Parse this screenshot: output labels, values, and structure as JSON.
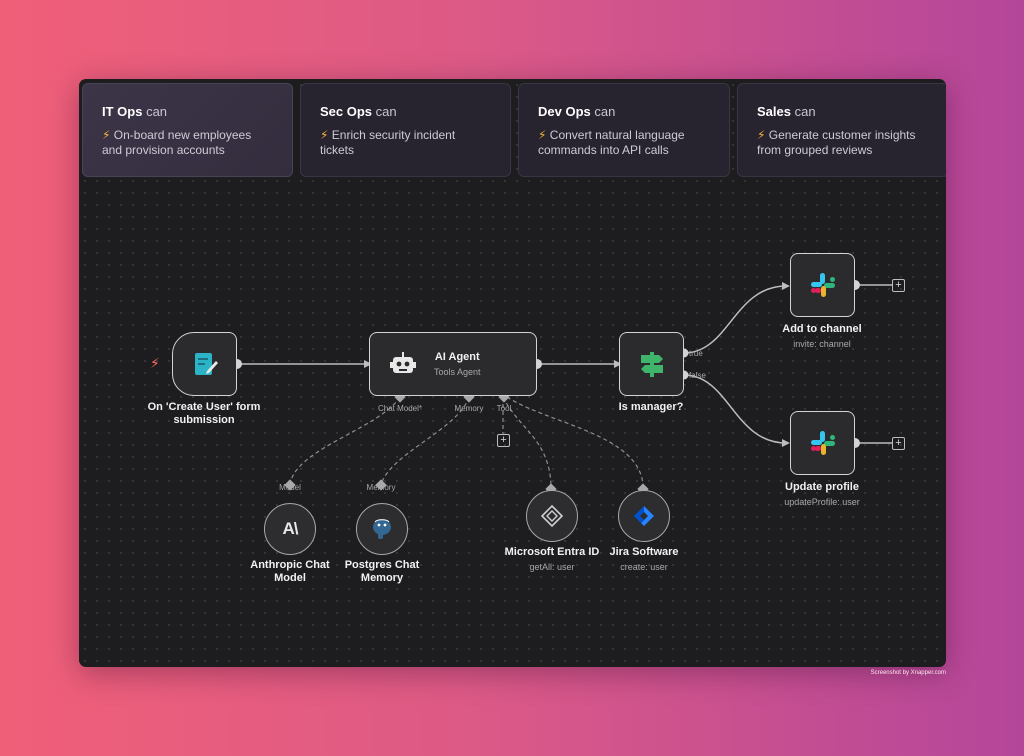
{
  "tabs": [
    {
      "team": "IT Ops",
      "can": "can",
      "bolt": "⚡",
      "desc": "On-board new employees and provision accounts",
      "active": true
    },
    {
      "team": "Sec Ops",
      "can": "can",
      "bolt": "⚡",
      "desc": "Enrich security incident tickets",
      "active": false
    },
    {
      "team": "Dev Ops",
      "can": "can",
      "bolt": "⚡",
      "desc": "Convert natural language commands into API calls",
      "active": false
    },
    {
      "team": "Sales",
      "can": "can",
      "bolt": "⚡",
      "desc": "Generate customer insights from grouped reviews",
      "active": false
    }
  ],
  "workflow": {
    "trigger": {
      "title": "On 'Create User' form submission",
      "icon": "form-icon"
    },
    "agent": {
      "title": "AI Agent",
      "subtitle": "Tools Agent",
      "icon": "robot-icon",
      "ports": {
        "chat_model": "Chat Model*",
        "memory": "Memory",
        "tool": "Tool"
      }
    },
    "if_node": {
      "title": "Is manager?",
      "icon": "signpost-icon",
      "true_label": "true",
      "false_label": "false"
    },
    "slack_add": {
      "title": "Add to channel",
      "subtitle": "invite: channel",
      "icon": "slack-icon"
    },
    "slack_update": {
      "title": "Update profile",
      "subtitle": "updateProfile: user",
      "icon": "slack-icon"
    },
    "anthropic": {
      "port": "Model",
      "title": "Anthropic Chat Model",
      "icon": "anthropic-icon"
    },
    "postgres": {
      "port": "Memory",
      "title": "Postgres Chat Memory",
      "icon": "postgres-icon"
    },
    "entra": {
      "title": "Microsoft Entra ID",
      "subtitle": "getAll: user",
      "icon": "entra-icon"
    },
    "jira": {
      "title": "Jira Software",
      "subtitle": "create: user",
      "icon": "jira-icon"
    },
    "plus": "+"
  },
  "colors": {
    "accent": "#ff6d5a",
    "bolt": "#f4b63a",
    "node_border": "#d3d3d3"
  },
  "credit": "Screenshot by Xnapper.com"
}
